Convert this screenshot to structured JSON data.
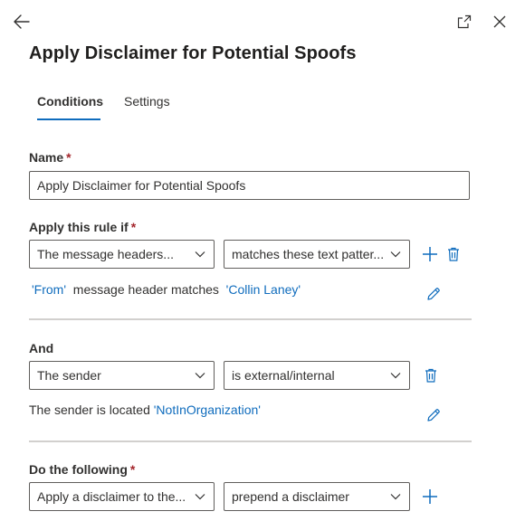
{
  "header": {
    "back_icon": "arrow-left-icon",
    "popout_icon": "popout-icon",
    "close_icon": "close-icon",
    "title": "Apply Disclaimer for Potential Spoofs"
  },
  "tabs": [
    {
      "label": "Conditions",
      "active": true
    },
    {
      "label": "Settings",
      "active": false
    }
  ],
  "name_field": {
    "label": "Name",
    "required_mark": "*",
    "value": "Apply Disclaimer for Potential Spoofs"
  },
  "apply_rule": {
    "label": "Apply this rule if",
    "required_mark": "*",
    "dropdown1": "The message headers...",
    "dropdown2": "matches these text patter...",
    "description": {
      "part1": "'From'",
      "part2": "message header matches",
      "part3": "'Collin Laney'"
    }
  },
  "and_section": {
    "label": "And",
    "dropdown1": "The sender",
    "dropdown2": "is external/internal",
    "description": {
      "part1": "The sender is located",
      "part2": "'NotInOrganization'"
    }
  },
  "do_following": {
    "label": "Do the following",
    "required_mark": "*",
    "dropdown1": "Apply a disclaimer to the...",
    "dropdown2": "prepend a disclaimer"
  },
  "colors": {
    "accent": "#0f6cbd",
    "required": "#a4262c",
    "divider": "#d2d0ce"
  }
}
